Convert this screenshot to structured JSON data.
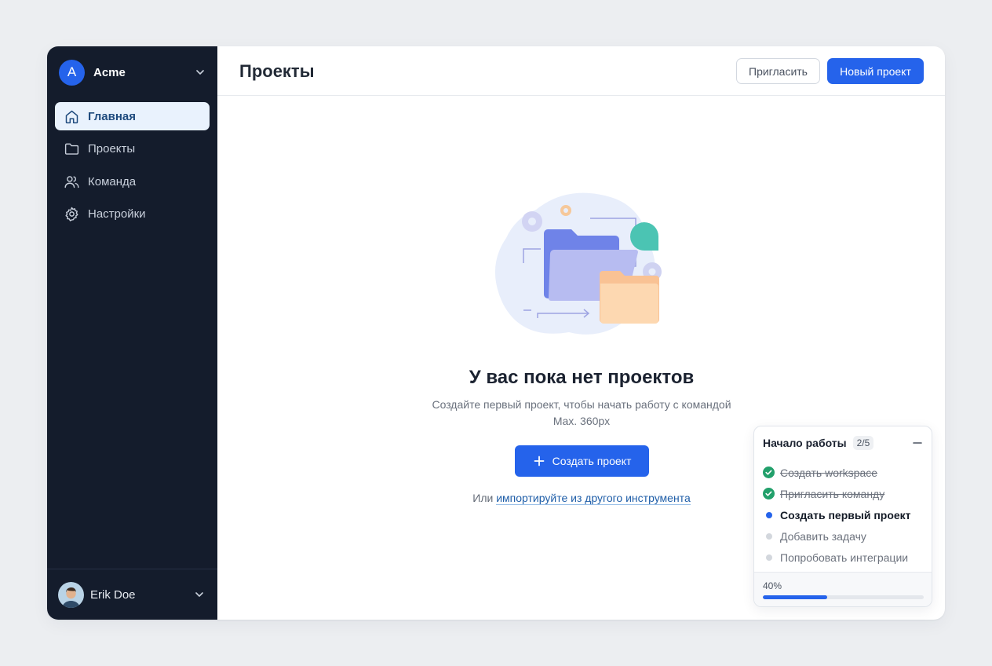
{
  "workspace": {
    "initial": "A",
    "name": "Acme"
  },
  "sidebar": {
    "items": [
      {
        "label": "Главная",
        "icon": "home-icon",
        "active": true
      },
      {
        "label": "Проекты",
        "icon": "folder-icon",
        "active": false
      },
      {
        "label": "Команда",
        "icon": "users-icon",
        "active": false
      },
      {
        "label": "Настройки",
        "icon": "gear-icon",
        "active": false
      }
    ]
  },
  "user": {
    "name": "Erik Doe"
  },
  "header": {
    "title": "Проекты",
    "invite_label": "Пригласить",
    "new_project_label": "Новый проект"
  },
  "empty_state": {
    "title": "У вас пока нет проектов",
    "description": "Создайте первый проект, чтобы начать работу с командой",
    "note": "Max. 360px",
    "create_label": "Создать проект",
    "import_prefix": "Или",
    "import_link": "импортируйте из другого инструмента"
  },
  "onboarding": {
    "title": "Начало работы",
    "badge": "2/5",
    "steps": [
      {
        "label": "Создать workspace",
        "status": "done"
      },
      {
        "label": "Пригласить команду",
        "status": "done"
      },
      {
        "label": "Создать первый проект",
        "status": "current"
      },
      {
        "label": "Добавить задачу",
        "status": "todo"
      },
      {
        "label": "Попробовать интеграции",
        "status": "todo"
      }
    ],
    "progress_label": "40%",
    "progress": 0.4
  },
  "colors": {
    "accent": "#2563eb",
    "sidebar_bg": "#141c2c",
    "done_green": "#22a06b"
  }
}
